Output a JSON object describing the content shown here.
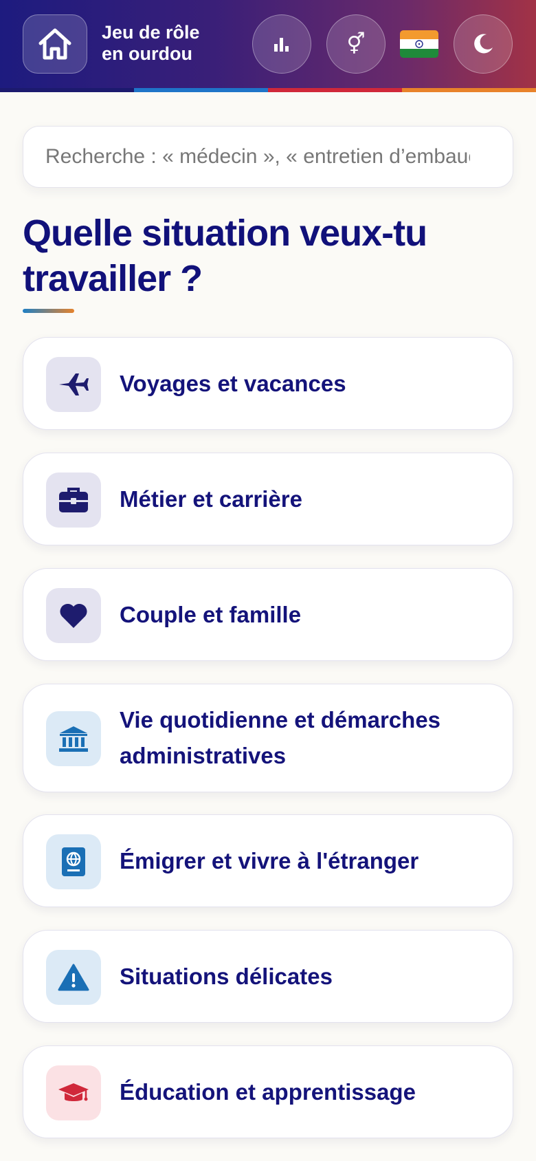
{
  "header": {
    "title_line1": "Jeu de rôle",
    "title_line2": "en ourdou",
    "home_icon": "home-icon",
    "stats_icon": "bar-chart-icon",
    "gender_icon": "gender-icon",
    "gender_glyph": "⚥",
    "language_flag": "india-flag",
    "theme_icon": "moon-icon",
    "stripe_colors": [
      "#1c1a6e",
      "#1f74c8",
      "#d0283a",
      "#e8822a"
    ]
  },
  "search": {
    "placeholder": "Recherche : « médecin », « entretien d’embauche »…",
    "value": ""
  },
  "page_title": "Quelle situation veux-tu travailler ?",
  "categories": [
    {
      "label": "Voyages et vacances",
      "icon": "airplane-icon",
      "icon_bg": "#e4e3f0",
      "icon_color": "#1e1c6e"
    },
    {
      "label": "Métier et carrière",
      "icon": "briefcase-icon",
      "icon_bg": "#e4e3f0",
      "icon_color": "#1e1c6e"
    },
    {
      "label": "Couple et famille",
      "icon": "heart-icon",
      "icon_bg": "#e4e3f0",
      "icon_color": "#1e1c6e"
    },
    {
      "label": "Vie quotidienne et démarches administratives",
      "icon": "bank-icon",
      "icon_bg": "#dceaf6",
      "icon_color": "#1a6fb5"
    },
    {
      "label": "Émigrer et vivre à l'étranger",
      "icon": "passport-icon",
      "icon_bg": "#dceaf6",
      "icon_color": "#1a6fb5"
    },
    {
      "label": "Situations délicates",
      "icon": "warning-icon",
      "icon_bg": "#dceaf6",
      "icon_color": "#1a6fb5"
    },
    {
      "label": "Éducation et apprentissage",
      "icon": "graduation-cap-icon",
      "icon_bg": "#fbe1e4",
      "icon_color": "#d0283a"
    }
  ]
}
